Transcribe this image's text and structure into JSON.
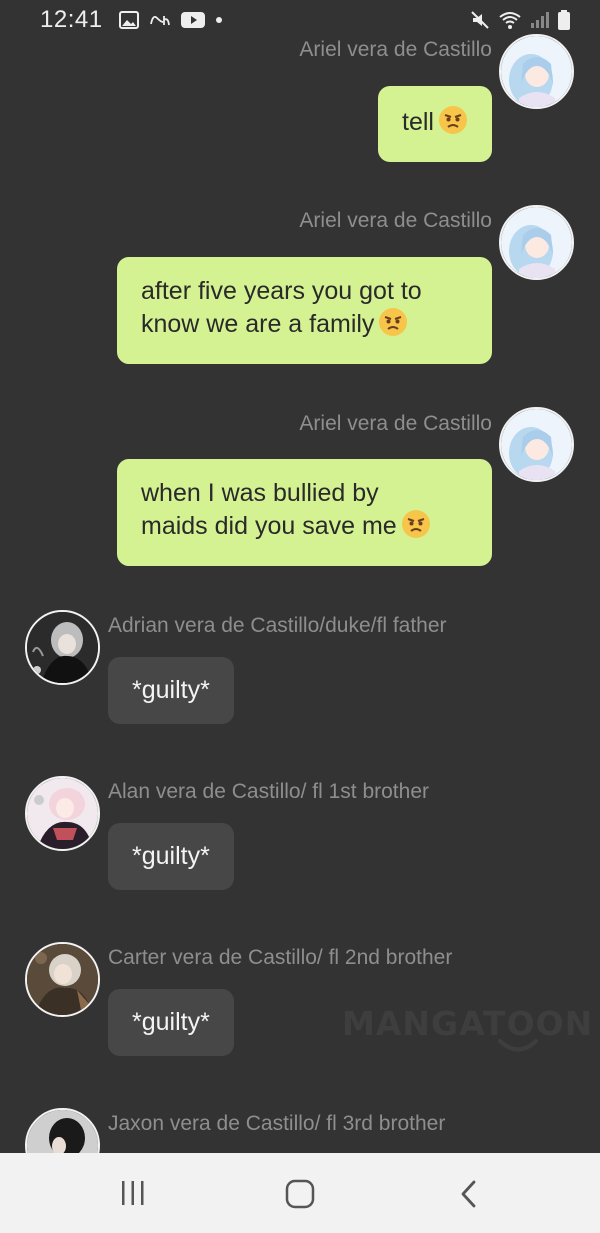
{
  "status_bar": {
    "time": "12:41",
    "left_icons": [
      "image-icon",
      "app-icon",
      "youtube-icon",
      "dot-icon"
    ],
    "right_icons": [
      "mute-icon",
      "wifi-icon",
      "signal-icon",
      "battery-icon"
    ]
  },
  "messages": [
    {
      "side": "right",
      "sender": "Ariel vera de Castillo",
      "text": "tell",
      "emoji": "angry-face-emoji"
    },
    {
      "side": "right",
      "sender": "Ariel vera de Castillo",
      "text_lines": [
        "after five years you got to",
        "know we are a family"
      ],
      "emoji": "angry-face-emoji"
    },
    {
      "side": "right",
      "sender": "Ariel vera de Castillo",
      "text_lines": [
        "when I was bullied by",
        "maids did you save me"
      ],
      "emoji": "angry-face-emoji"
    },
    {
      "side": "left",
      "sender": "Adrian vera de Castillo/duke/fl father",
      "text": "*guilty*"
    },
    {
      "side": "left",
      "sender": "Alan vera de Castillo/ fl 1st brother",
      "text": "*guilty*"
    },
    {
      "side": "left",
      "sender": "Carter vera de Castillo/ fl 2nd brother",
      "text": "*guilty*"
    },
    {
      "side": "left",
      "sender": "Jaxon vera de Castillo/ fl 3rd brother"
    }
  ],
  "watermark": "MANGATOON",
  "nav_bar": {
    "buttons": [
      "recent-apps-icon",
      "home-icon",
      "back-icon"
    ]
  },
  "colors": {
    "background": "#333333",
    "my_bubble": "#d5f292",
    "other_bubble": "#474747",
    "sender_text": "#8e8e8e",
    "nav_bar": "#f2f2f2"
  }
}
